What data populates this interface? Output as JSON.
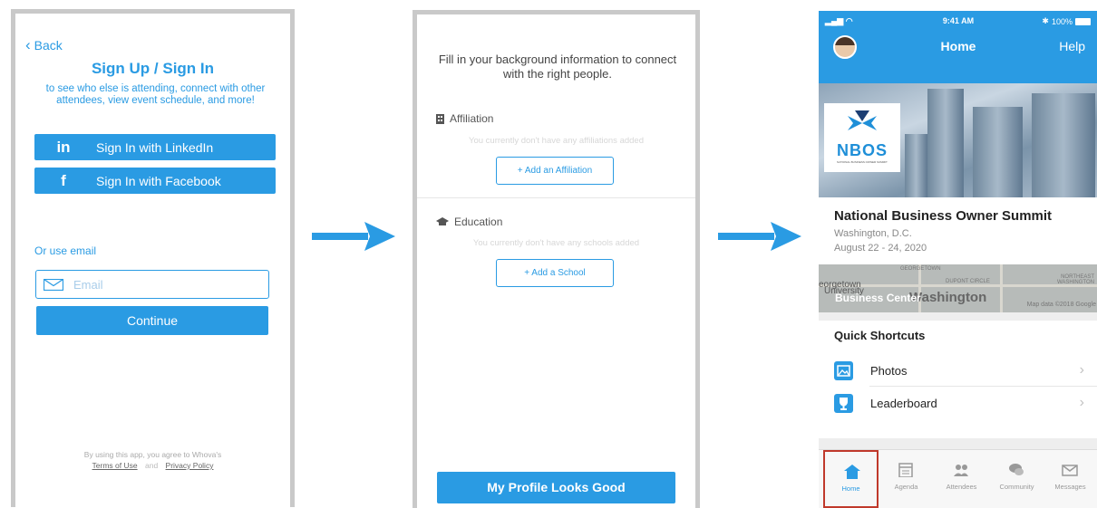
{
  "screen1": {
    "back_label": "Back",
    "title": "Sign Up / Sign In",
    "subtitle": "to see who else is attending, connect with other attendees, view event schedule, and more!",
    "linkedin_label": "Sign In with LinkedIn",
    "linkedin_icon": "in",
    "facebook_label": "Sign In with Facebook",
    "facebook_icon": "f",
    "or_email": "Or use email",
    "email_placeholder": "Email",
    "continue_label": "Continue",
    "legal_text": "By using this app, you agree to Whova's",
    "terms_label": "Terms of Use",
    "and_label": "and",
    "privacy_label": "Privacy Policy"
  },
  "screen2": {
    "heading": "Fill in your background information to connect with the right people.",
    "affiliation_label": "Affiliation",
    "affiliation_empty": "You currently don't have any affiliations added",
    "add_affiliation": "+ Add an Affiliation",
    "education_label": "Education",
    "education_empty": "You currently don't have any schools added",
    "add_school": "+ Add a School",
    "profile_button": "My Profile Looks Good"
  },
  "screen3": {
    "status": {
      "time": "9:41 AM",
      "battery": "100%"
    },
    "nav": {
      "title": "Home",
      "help": "Help"
    },
    "logo_text": "NBOS",
    "logo_caption": "NATIONAL BUSINESS OWNER SUMMIT",
    "event": {
      "title": "National Business Owner Summit",
      "location": "Washington, D.C.",
      "dates": "August 22 - 24, 2020"
    },
    "map": {
      "venue": "Business Center",
      "city": "Washington",
      "neighborhood_1": "eorgetown",
      "neighborhood_2": "University",
      "label_georgetown": "GEORGETOWN",
      "label_dupont": "DUPONT CIRCLE",
      "label_northeast": "NORTHEAST WASHINGTON",
      "credit": "Map data ©2018 Google"
    },
    "shortcuts": {
      "title": "Quick Shortcuts",
      "items": [
        {
          "label": "Photos",
          "icon": "photo-icon"
        },
        {
          "label": "Leaderboard",
          "icon": "trophy-icon"
        }
      ]
    },
    "tabs": [
      {
        "label": "Home",
        "icon": "home-icon",
        "active": true
      },
      {
        "label": "Agenda",
        "icon": "calendar-icon",
        "active": false
      },
      {
        "label": "Attendees",
        "icon": "people-icon",
        "active": false
      },
      {
        "label": "Community",
        "icon": "chat-icon",
        "active": false
      },
      {
        "label": "Messages",
        "icon": "mail-icon",
        "active": false
      }
    ],
    "colors": {
      "accent": "#2a9be3",
      "highlight": "#c0392b"
    }
  }
}
